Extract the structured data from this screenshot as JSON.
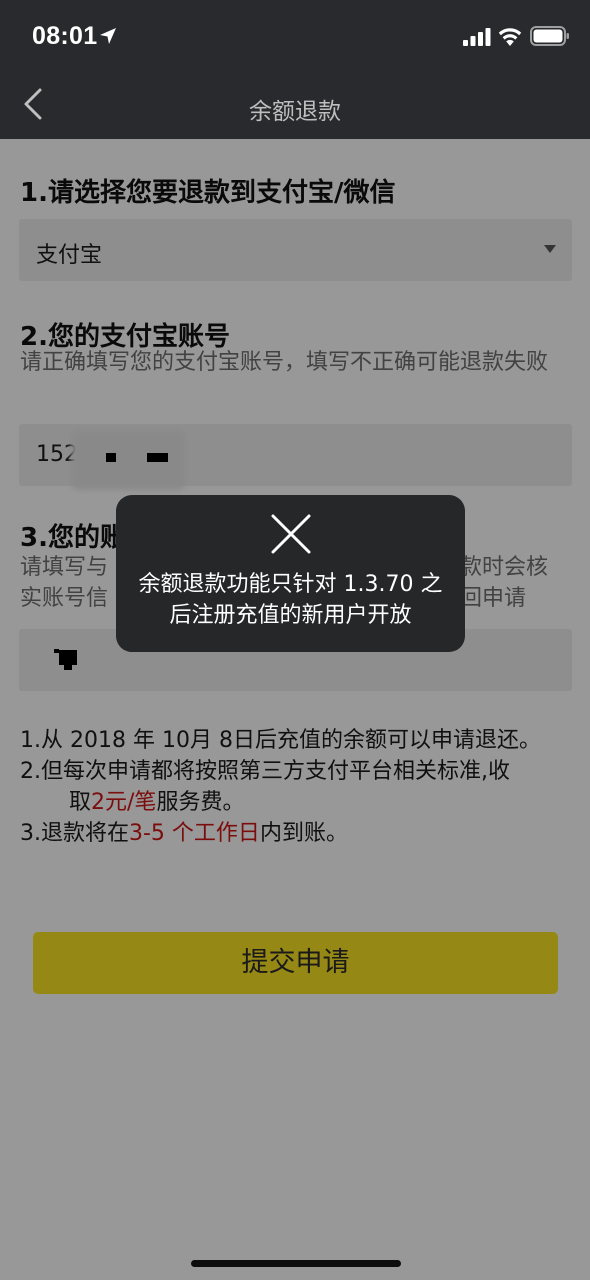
{
  "status_bar": {
    "time": "08:01"
  },
  "nav": {
    "title": "余额退款"
  },
  "section1": {
    "title": "1.请选择您要退款到支付宝/微信",
    "selected_value": "支付宝"
  },
  "section2": {
    "title": "2.您的支付宝账号",
    "hint": "请正确填写您的支付宝账号，填写不正确可能退款失败",
    "value": "15256"
  },
  "section3": {
    "title_visible": "3.您的账",
    "hint_line1_left": "请填写与",
    "hint_line1_right": "款时会核",
    "hint_line2_left": "实账号信",
    "hint_line2_right": "回申请"
  },
  "rules": {
    "line1": "1.从 2018 年 10月 8日后充值的余额可以申请退还。",
    "line2_part1": "2.但每次申请都将按照第三方支付平台相关标准,收",
    "line2_part2_a": "取",
    "line2_part2_red": "2元/笔",
    "line2_part2_b": "服务费。",
    "line3_a": "3.退款将在",
    "line3_red": "3-5 个工作日",
    "line3_b": "内到账。"
  },
  "submit": {
    "label": "提交申请"
  },
  "toast": {
    "icon": "close-icon",
    "line1": "余额退款功能只针对 1.3.70 之",
    "line2": "后注册充值的新用户开放"
  },
  "colors": {
    "accent": "#f2dc22",
    "highlight": "#c71515",
    "navbar": "#282a2d",
    "toast_bg": "#262729"
  }
}
